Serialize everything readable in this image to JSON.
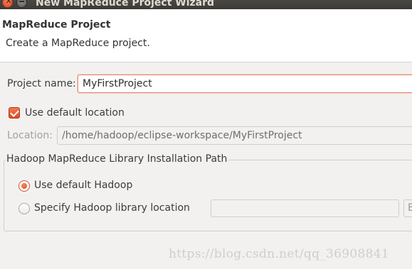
{
  "window": {
    "title": "New MapReduce Project Wizard"
  },
  "header": {
    "title": "MapReduce Project",
    "description": "Create a MapReduce project."
  },
  "form": {
    "project_name_label": "Project name:",
    "project_name_value": "MyFirstProject",
    "use_default_location_label": "Use default location",
    "use_default_location_checked": true,
    "location_label": "Location:",
    "location_value": "/home/hadoop/eclipse-workspace/MyFirstProject"
  },
  "hadoop_group": {
    "title": "Hadoop MapReduce Library Installation Path",
    "use_default_label": "Use default Hadoop",
    "specify_label": "Specify Hadoop library location",
    "selected": "use_default",
    "library_path_value": "",
    "browse_label": "B"
  },
  "watermark": "https://blog.csdn.net/qq_36908841",
  "colors": {
    "accent": "#dd4814",
    "titlebar": "#3c3b37",
    "header_bg": "#ffffff",
    "panel_bg": "#f2f1f0"
  }
}
